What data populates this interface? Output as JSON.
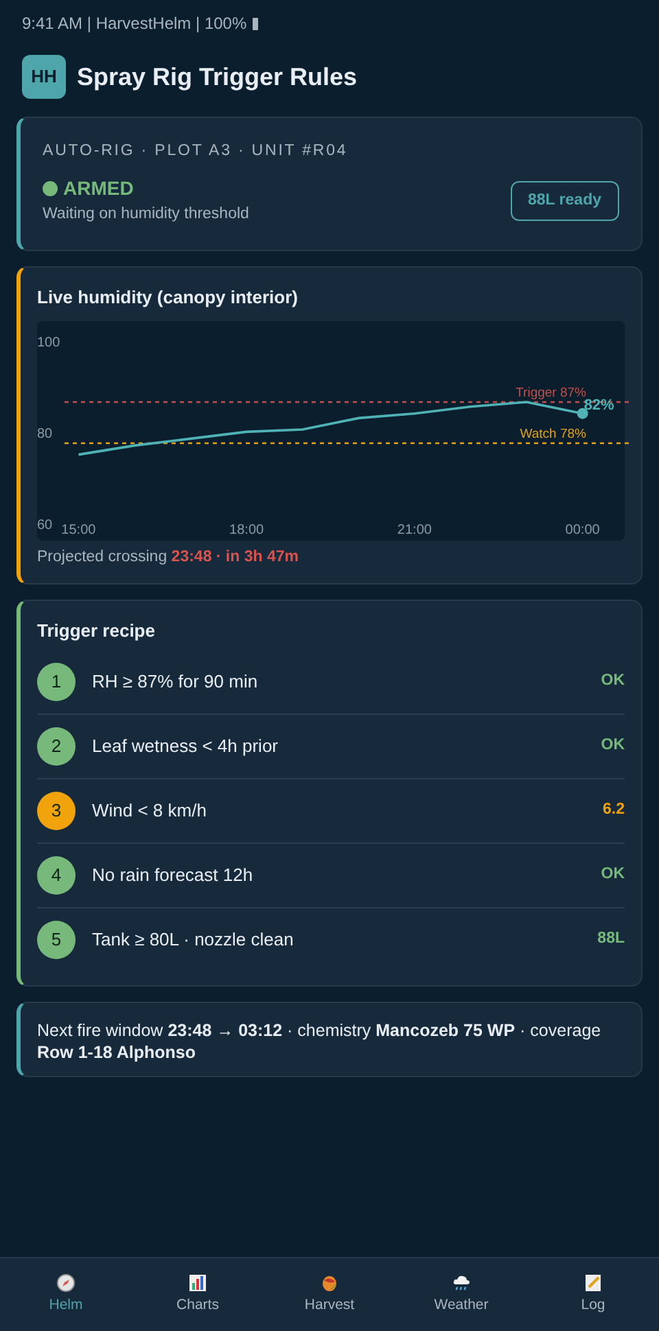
{
  "status_bar": {
    "text": "9:41 AM | HarvestHelm | 100%"
  },
  "header": {
    "logo": "HH",
    "title": "Spray Rig Trigger Rules"
  },
  "rig": {
    "meta": "AUTO-RIG · PLOT A3 · UNIT #R04",
    "state": "ARMED",
    "armed": true,
    "note": "Waiting on humidity threshold",
    "tank_button": "88L ready"
  },
  "humidity": {
    "title": "Live humidity (canopy interior)",
    "chart_data": {
      "type": "line",
      "x": [
        15,
        16,
        17,
        18,
        19,
        20,
        21,
        22,
        23,
        24
      ],
      "series": [
        {
          "color": "#4fb3b5",
          "values": [
            75.5,
            77.5,
            79,
            80.5,
            81,
            83.5,
            84.5,
            86,
            87,
            84.5
          ]
        }
      ],
      "xlim": [
        14.75,
        24.85
      ],
      "ylim": [
        60,
        100
      ],
      "yticks": [
        60,
        80,
        100
      ],
      "xticks": [
        {
          "value": 15,
          "label": "15:00"
        },
        {
          "value": 18,
          "label": "18:00"
        },
        {
          "value": 21,
          "label": "21:00"
        },
        {
          "value": 24,
          "label": "00:00"
        }
      ],
      "ref_lines": [
        {
          "axis": "y",
          "value": 87,
          "label": "Trigger 87%",
          "color": "#c0504d"
        },
        {
          "axis": "y",
          "value": 78,
          "label": "Watch 78%",
          "color": "#e3a21a"
        }
      ],
      "annotations": [
        {
          "text": "82%",
          "x": 24,
          "y": 84.5
        }
      ]
    },
    "projection_label": "Projected crossing",
    "projection_value": "23:48 · in 3h 47m"
  },
  "recipe": {
    "title": "Trigger recipe",
    "steps": [
      {
        "number": "1",
        "label": "RH ≥ 87% for 90 min",
        "value": "OK",
        "color": "#76b97a"
      },
      {
        "number": "2",
        "label": "Leaf wetness < 4h prior",
        "value": "OK",
        "color": "#76b97a"
      },
      {
        "number": "3",
        "label": "Wind < 8 km/h",
        "value": "6.2",
        "color": "#f0a30a"
      },
      {
        "number": "4",
        "label": "No rain forecast 12h",
        "value": "OK",
        "color": "#76b97a"
      },
      {
        "number": "5",
        "label": "Tank ≥ 80L · nozzle clean",
        "value": "88L",
        "color": "#76b97a"
      }
    ]
  },
  "summary": "Next fire window **23:48 → 03:12** · chemistry **Mancozeb 75 WP** · coverage **Row 1-18 Alphonso**",
  "nav": [
    {
      "label": "Helm",
      "selected": true
    },
    {
      "label": "Charts",
      "selected": false
    },
    {
      "label": "Harvest",
      "selected": false
    },
    {
      "label": "Weather",
      "selected": false
    },
    {
      "label": "Log",
      "selected": false
    }
  ]
}
